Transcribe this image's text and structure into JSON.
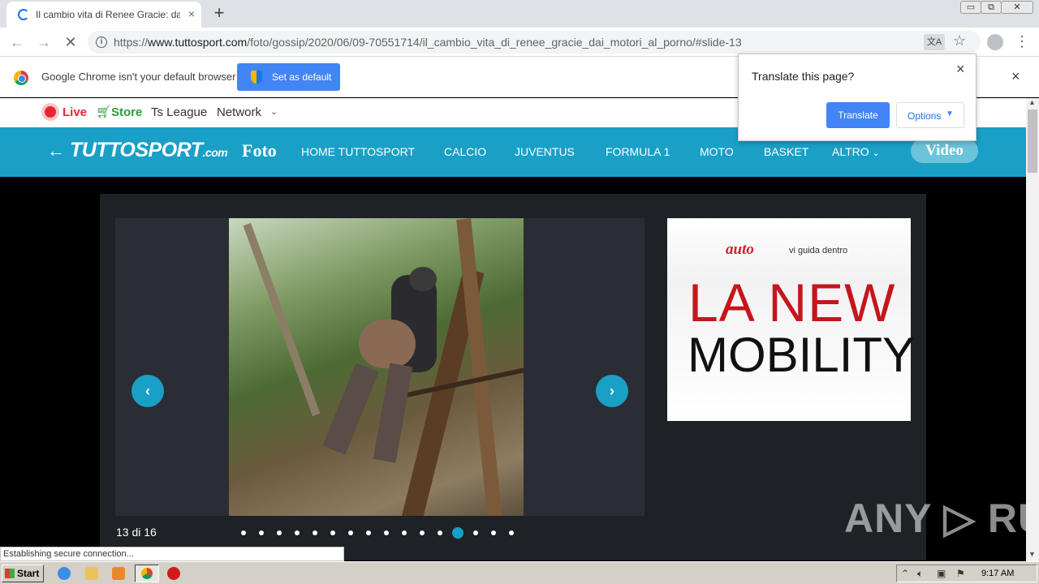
{
  "browser": {
    "tab_title": "Il cambio vita di Renee Gracie: dai m",
    "url_prefix": "https://",
    "url_host": "www.tuttosport.com",
    "url_path": "/foto/gossip/2020/06/09-70551714/il_cambio_vita_di_renee_gracie_dai_motori_al_porno/#slide-13",
    "new_tab": "+",
    "tab_close": "×",
    "window_buttons": [
      "▭",
      "⧉",
      "✕"
    ]
  },
  "infobar": {
    "message": "Google Chrome isn't your default browser",
    "button": "Set as default",
    "close": "×"
  },
  "translate_popup": {
    "title": "Translate this page?",
    "translate_button": "Translate",
    "options_button": "Options",
    "close": "×"
  },
  "site": {
    "topbar": {
      "live": "Live",
      "store": "Store",
      "league": "Ts League",
      "network": "Network"
    },
    "logo": "TUTTOSPORT",
    "logo_suffix": ".com",
    "section": "Foto",
    "nav": [
      "HOME TUTTOSPORT",
      "CALCIO",
      "JUVENTUS",
      "FORMULA 1",
      "MOTO",
      "BASKET",
      "ALTRO"
    ],
    "video": "Video"
  },
  "gallery": {
    "counter": "13 di 16",
    "current_slide": 13,
    "total_slides": 16
  },
  "ad": {
    "brand": "auto",
    "tagline": "vi guida dentro",
    "line1": "LA NEW",
    "line2": "MOBILITY"
  },
  "watermark": "ANY ▷ RUN",
  "status": "Establishing secure connection...",
  "taskbar": {
    "start": "Start",
    "clock": "9:17 AM"
  },
  "colors": {
    "site_accent": "#1a9fc7",
    "live_red": "#e8252f",
    "store_green": "#2e9b3a",
    "chrome_blue": "#4285f4"
  }
}
